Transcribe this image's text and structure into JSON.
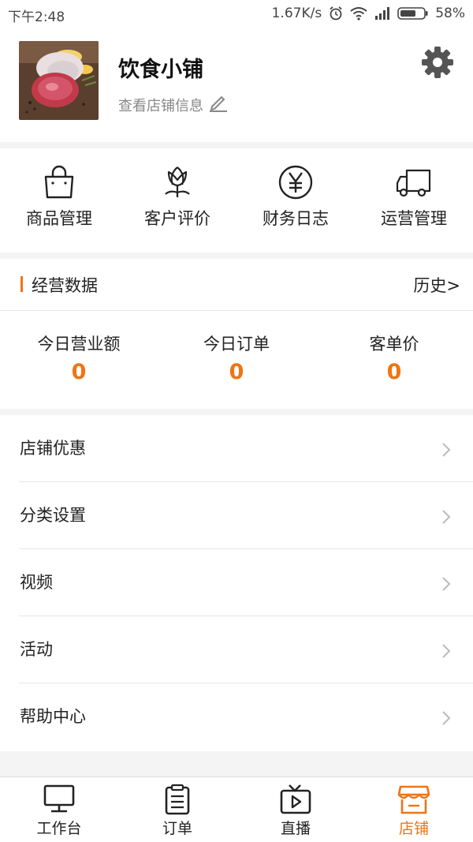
{
  "status_bar": {
    "time": "下午2:48",
    "net_speed": "1.67K/s",
    "battery": "58%"
  },
  "header": {
    "shop_name": "饮食小铺",
    "shop_info_link": "查看店铺信息"
  },
  "quick_actions": [
    {
      "label": "商品管理",
      "icon": "shopping-bag-icon"
    },
    {
      "label": "客户评价",
      "icon": "flower-icon"
    },
    {
      "label": "财务日志",
      "icon": "yen-icon"
    },
    {
      "label": "运营管理",
      "icon": "truck-icon"
    }
  ],
  "business": {
    "title": "经营数据",
    "history": "历史>",
    "stats": [
      {
        "label": "今日营业额",
        "value": "0"
      },
      {
        "label": "今日订单",
        "value": "0"
      },
      {
        "label": "客单价",
        "value": "0"
      }
    ]
  },
  "menu": [
    {
      "label": "店铺优惠"
    },
    {
      "label": "分类设置"
    },
    {
      "label": "视频"
    },
    {
      "label": "活动"
    },
    {
      "label": "帮助中心"
    }
  ],
  "tabs": [
    {
      "label": "工作台",
      "icon": "monitor-icon"
    },
    {
      "label": "订单",
      "icon": "clipboard-icon"
    },
    {
      "label": "直播",
      "icon": "tv-play-icon"
    },
    {
      "label": "店铺",
      "icon": "store-icon",
      "active": true
    }
  ],
  "colors": {
    "accent": "#f07414"
  }
}
